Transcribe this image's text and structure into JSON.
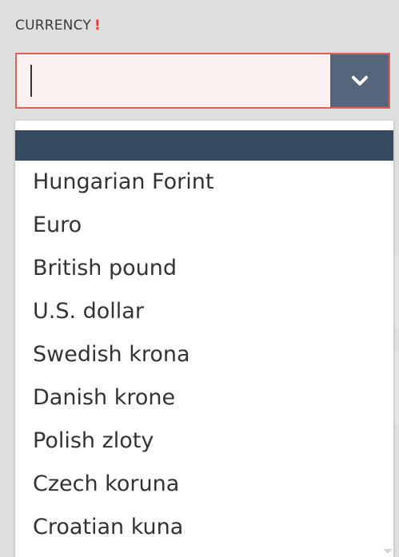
{
  "field": {
    "label": "CURRENCY",
    "required_mark": "!",
    "value": "",
    "toggle_icon": "chevron-down-icon"
  },
  "colors": {
    "required": "#e53935",
    "input_border": "#e0605a",
    "input_background": "#fdf1f1",
    "toggle_background": "#56657a",
    "dropdown_header": "#354a5e"
  },
  "dropdown": {
    "options": [
      "Hungarian Forint",
      "Euro",
      "British pound",
      "U.S. dollar",
      "Swedish krona",
      "Danish krone",
      "Polish zloty",
      "Czech koruna",
      "Croatian kuna"
    ]
  }
}
